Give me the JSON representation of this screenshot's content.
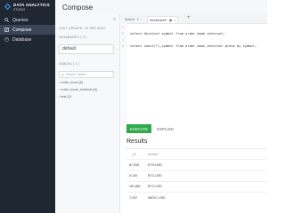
{
  "sidebar": {
    "brand_line1": "DATA ANALYTICS",
    "brand_line2": "STUDIO",
    "items": [
      {
        "label": "Queries",
        "icon": "search-icon"
      },
      {
        "label": "Compose",
        "icon": "compose-icon",
        "active": true
      },
      {
        "label": "Database",
        "icon": "database-icon"
      }
    ]
  },
  "header": {
    "title": "Compose"
  },
  "left_panel": {
    "last_update": "LAST UPDATE: 10 sec ago.",
    "databases_label": "DATABASES ( 3 )",
    "database_value": "default",
    "tables_label": "TABLES ( 3 )",
    "search_placeholder": "Search Tables",
    "tables": [
      "order_book (6)",
      "order_book_external (6)",
      "test (2)"
    ]
  },
  "editor": {
    "tabs": [
      "Saved",
      "Worksheet*"
    ],
    "lines": [
      {
        "n": "1",
        "code": ""
      },
      {
        "n": "2",
        "code": "select distinct symbol from order_book_external;"
      },
      {
        "n": "3",
        "code": ""
      },
      {
        "n": "4",
        "code": "select count(*),symbol from order_book_external group by symbol;"
      }
    ]
  },
  "actions": {
    "execute": "EXECUTE",
    "explain": "EXPLAIN"
  },
  "results": {
    "title": "Results",
    "columns": [
      "_c0",
      "symbol"
    ],
    "rows": [
      [
        "87,008",
        "ETH-USD"
      ],
      [
        "8,126",
        "BTC-USD"
      ],
      [
        "181,881",
        "BTC-USD"
      ],
      [
        "7,202",
        "MATIC-USD"
      ]
    ]
  },
  "colors": {
    "sidebar": "#1f2733",
    "accent": "#2eaa4b"
  }
}
